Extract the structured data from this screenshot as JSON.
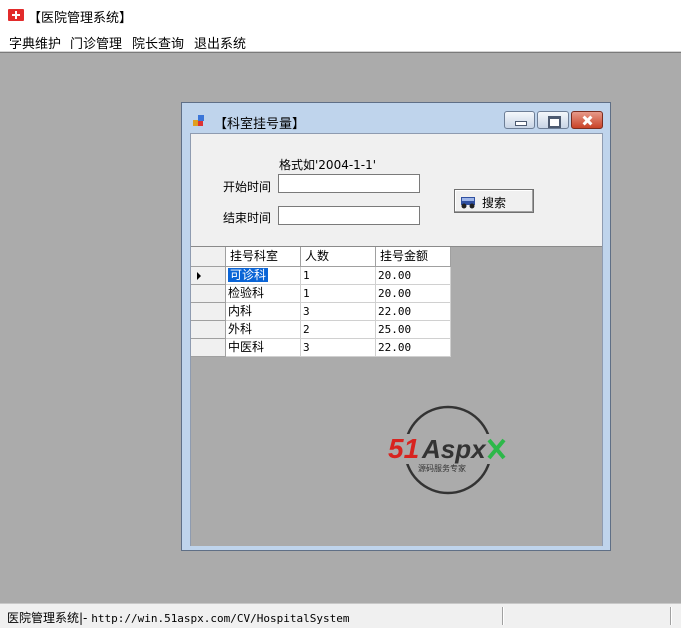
{
  "window": {
    "title": "【医院管理系统】"
  },
  "menu": [
    "字典维护",
    "门诊管理",
    "院长查询",
    "退出系统"
  ],
  "child_window": {
    "title": "【科室挂号量】",
    "format_hint": "格式如'2004-1-1'",
    "start_label": "开始时间",
    "end_label": "结束时间",
    "start_value": "",
    "end_value": "",
    "search_label": "搜索"
  },
  "grid": {
    "columns": [
      "挂号科室",
      "人数",
      "挂号金额"
    ],
    "rows": [
      [
        "可诊科",
        "1",
        "20.00"
      ],
      [
        "检验科",
        "1",
        "20.00"
      ],
      [
        "内科",
        "3",
        "22.00"
      ],
      [
        "外科",
        "2",
        "25.00"
      ],
      [
        "中医科",
        "3",
        "22.00"
      ]
    ],
    "selected_row": 0
  },
  "watermark": {
    "brand": "51Aspx",
    "tagline": "源码服务专家"
  },
  "status": {
    "app": "医院管理系统",
    "sep": "|-",
    "url": "http://win.51aspx.com/CV/HospitalSystem"
  },
  "colors": {
    "mdi_bg": "#ababab",
    "child_border": "#bfd4ec",
    "selection": "#0a64d6",
    "brand_red": "#d8231f",
    "brand_green": "#2db84a"
  }
}
